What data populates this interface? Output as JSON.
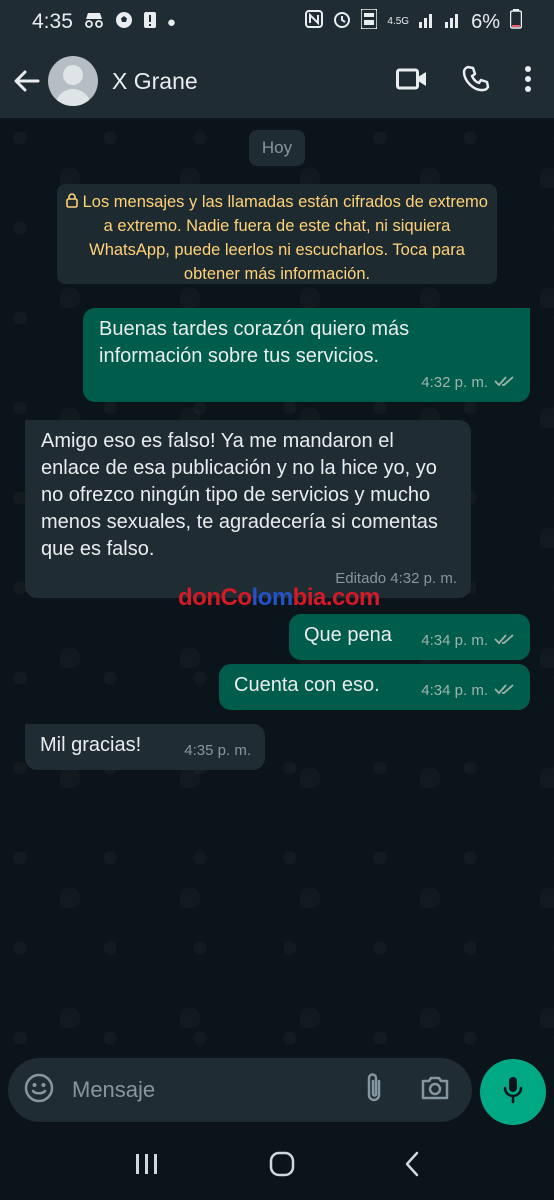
{
  "status_bar": {
    "time": "4:35",
    "network": "4.5G",
    "battery": "6%"
  },
  "header": {
    "contact_name": "X Grane"
  },
  "chat": {
    "date_chip": "Hoy",
    "encryption_notice": "Los mensajes y las llamadas están cifrados de extremo a extremo. Nadie fuera de este chat, ni siquiera WhatsApp, puede leerlos ni escucharlos. Toca para obtener más información.",
    "messages": [
      {
        "direction": "out",
        "text": "Buenas tardes corazón quiero más información sobre tus servicios.",
        "time": "4:32 p. m."
      },
      {
        "direction": "in",
        "text": "Amigo eso es falso! Ya me mandaron el enlace de esa publicación y no la hice yo, yo no ofrezco ningún tipo de servicios y mucho menos sexuales, te agradecería si comentas que es falso.",
        "time": "Editado 4:32 p. m."
      },
      {
        "direction": "out",
        "text": "Que pena",
        "time": "4:34 p. m."
      },
      {
        "direction": "out",
        "text": "Cuenta con eso.",
        "time": "4:34 p. m."
      },
      {
        "direction": "in",
        "text": "Mil gracias!",
        "time": "4:35 p. m."
      }
    ],
    "watermark": {
      "part1": "donCo",
      "part2": "lom",
      "part3": "bia.com"
    }
  },
  "input": {
    "placeholder": "Mensaje"
  },
  "colors": {
    "outgoing_bubble": "#005c4b",
    "incoming_bubble": "#1f2c34",
    "accent": "#00a884",
    "encryption_text": "#ffd279"
  }
}
